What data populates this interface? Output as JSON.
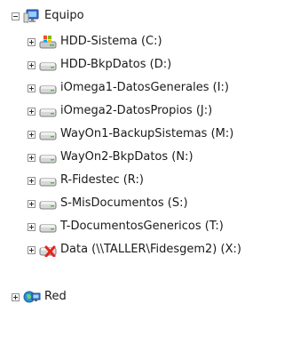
{
  "tree": {
    "root": {
      "label": "Equipo",
      "icon": "computer-icon",
      "expanded": true
    },
    "drives": [
      {
        "label": "HDD-Sistema (C:)",
        "icon": "system-drive-icon"
      },
      {
        "label": "HDD-BkpDatos (D:)",
        "icon": "hard-drive-icon"
      },
      {
        "label": "iOmega1-DatosGenerales (I:)",
        "icon": "hard-drive-icon"
      },
      {
        "label": "iOmega2-DatosPropios (J:)",
        "icon": "hard-drive-icon"
      },
      {
        "label": "WayOn1-BackupSistemas (M:)",
        "icon": "hard-drive-icon"
      },
      {
        "label": "WayOn2-BkpDatos (N:)",
        "icon": "hard-drive-icon"
      },
      {
        "label": "R-Fidestec (R:)",
        "icon": "hard-drive-icon"
      },
      {
        "label": "S-MisDocumentos (S:)",
        "icon": "hard-drive-icon"
      },
      {
        "label": "T-DocumentosGenericos (T:)",
        "icon": "hard-drive-icon"
      },
      {
        "label": "Data (\\\\TALLER\\Fidesgem2) (X:)",
        "icon": "disconnected-network-drive-icon"
      }
    ],
    "network": {
      "label": "Red",
      "icon": "network-icon",
      "expanded": false
    }
  }
}
